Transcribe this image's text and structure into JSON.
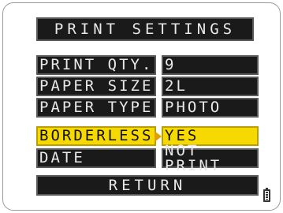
{
  "title": "PRINT SETTINGS",
  "settings": [
    {
      "label": "PRINT QTY.",
      "value": "9"
    },
    {
      "label": "PAPER SIZE",
      "value": "2L"
    },
    {
      "label": "PAPER TYPE",
      "value": "PHOTO"
    },
    {
      "label": "BORDERLESS",
      "value": "YES"
    },
    {
      "label": "DATE",
      "value": "NOT PRINT"
    }
  ],
  "selected_index": 3,
  "return_label": "RETURN",
  "battery_icon": "battery-icon",
  "colors": {
    "highlight": "#f6d900",
    "bar": "#1a1a1a",
    "text": "#e9e9e9"
  }
}
